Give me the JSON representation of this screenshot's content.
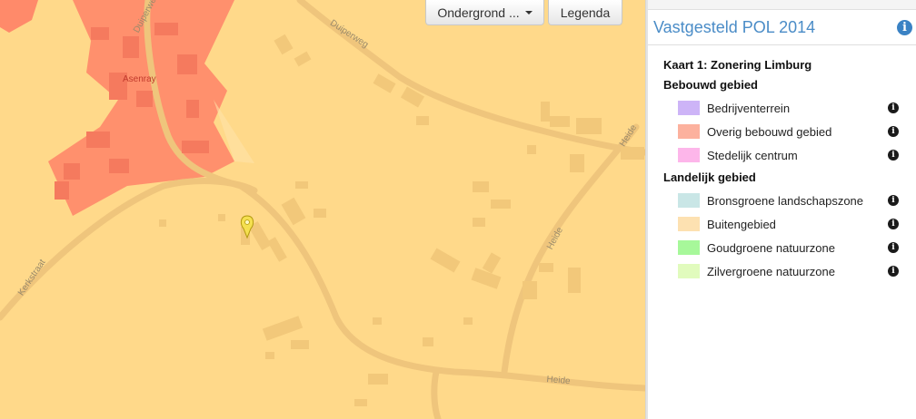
{
  "map": {
    "basemap_button_label": "Ondergrond ...",
    "legend_button_label": "Legenda",
    "place_label": "Asenray",
    "road_labels": {
      "duiperweg_1": "Duiperweg",
      "duiperweg_2": "Duiperweg",
      "kerkstraat": "Kerkstraat",
      "heide_1": "Heide",
      "heide_2": "Heide",
      "heide_3": "Heide"
    },
    "colors": {
      "buitengebied": "#ffd98a",
      "bebouwd": "#ff8a6a",
      "road": "#f0c67e"
    }
  },
  "panel": {
    "title": "Vastgesteld POL 2014",
    "map_title": "Kaart 1: Zonering Limburg",
    "groups": [
      {
        "title": "Bebouwd gebied",
        "items": [
          {
            "label": "Bedrijventerrein",
            "color": "#cdb4f7"
          },
          {
            "label": "Overig bebouwd gebied",
            "color": "#fcb19e"
          },
          {
            "label": "Stedelijk centrum",
            "color": "#fdb6ea"
          }
        ]
      },
      {
        "title": "Landelijk gebied",
        "items": [
          {
            "label": "Bronsgroene landschapszone",
            "color": "#c9e6e6"
          },
          {
            "label": "Buitengebied",
            "color": "#fde1b1"
          },
          {
            "label": "Goudgroene natuurzone",
            "color": "#a7f89a"
          },
          {
            "label": "Zilvergroene natuurzone",
            "color": "#e1fbbd"
          }
        ]
      }
    ]
  }
}
